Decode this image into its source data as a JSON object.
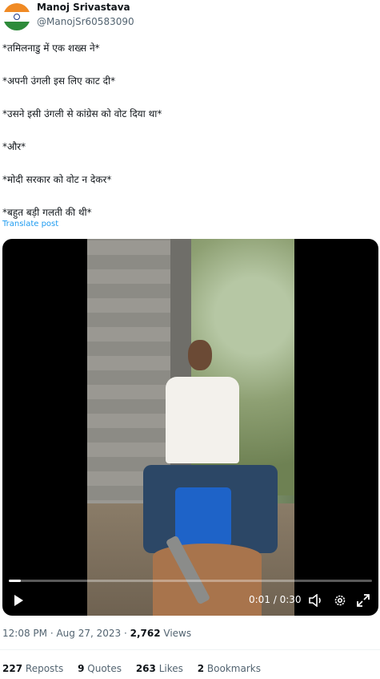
{
  "author": {
    "name": "Manoj Srivastava",
    "handle": "@ManojSr60583090",
    "avatar_icon": "india-flag-avatar"
  },
  "tweet": {
    "lines": [
      "*तमिलनाडु में एक शख्स ने*",
      "*अपनी उंगली इस लिए काट दी*",
      "*उसने इसी उंगली से कांग्रेस को वोट दिया था*",
      "*और*",
      "*मोदी सरकार को वोट न देकर*",
      "*बहुत बड़ी गलती की थी*"
    ],
    "translate_label": "Translate post"
  },
  "video": {
    "time": "0:01 / 0:30",
    "progress_fraction": 0.033,
    "controls": [
      "play-icon",
      "volume-icon",
      "settings-icon",
      "fullscreen-icon"
    ]
  },
  "meta": {
    "time": "12:08 PM",
    "separator": " · ",
    "date": "Aug 27, 2023",
    "views_count": "2,762",
    "views_label": "Views"
  },
  "stats": [
    {
      "count": "227",
      "label": "Reposts"
    },
    {
      "count": "9",
      "label": "Quotes"
    },
    {
      "count": "263",
      "label": "Likes"
    },
    {
      "count": "2",
      "label": "Bookmarks"
    }
  ],
  "colors": {
    "text": "#0f1419",
    "secondary": "#536471",
    "link": "#1d9bf0"
  }
}
